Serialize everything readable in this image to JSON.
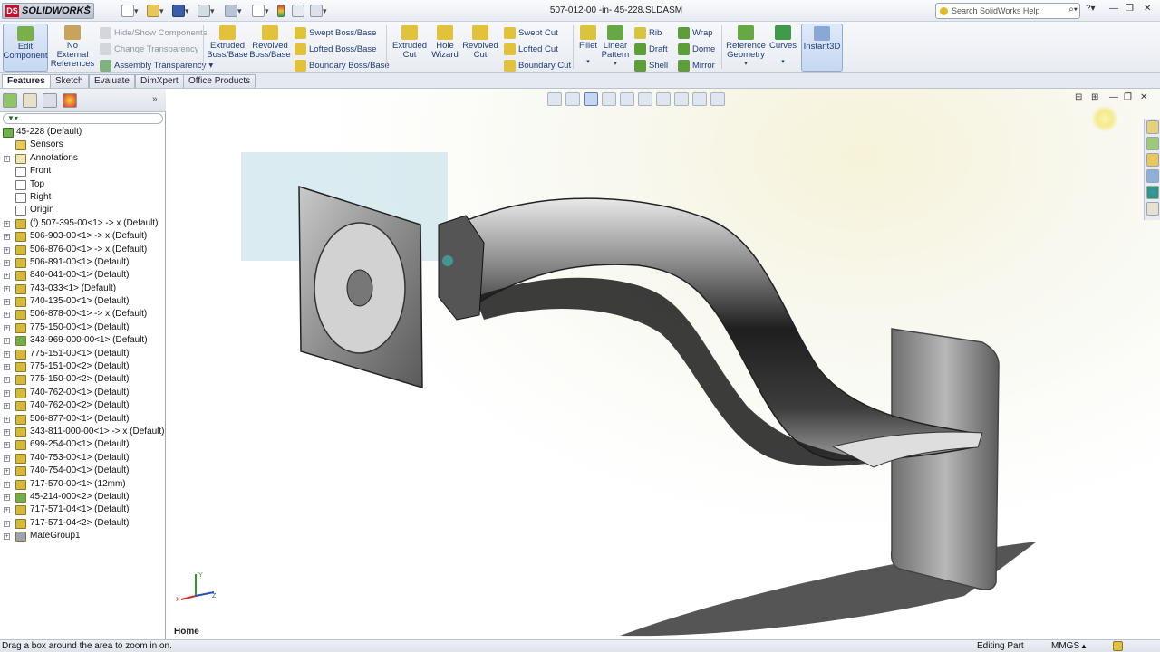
{
  "colors": {
    "accent": "#1f3d7a",
    "brand": "#c8102e",
    "selection": "#c6d8f2"
  },
  "titlebar": {
    "app_name": "SOLIDWORKS",
    "logo_mark": "DS",
    "doc_title": "507-012-00 -in- 45-228.SLDASM",
    "search_placeholder": "Search SolidWorks Help",
    "icons": [
      "new-icon",
      "open-icon",
      "save-icon",
      "print-icon",
      "undo-icon",
      "select-icon",
      "rebuild-icon",
      "options-icon"
    ]
  },
  "ribbon": {
    "edit_component": "Edit Component",
    "no_external_refs": "No External References",
    "hide_show": "Hide/Show Components",
    "change_transparency": "Change Transparency",
    "assembly_transparency": "Assembly Transparency",
    "extruded_boss": "Extruded Boss/Base",
    "revolved_boss": "Revolved Boss/Base",
    "swept_boss": "Swept Boss/Base",
    "lofted_boss": "Lofted Boss/Base",
    "boundary_boss": "Boundary Boss/Base",
    "extruded_cut": "Extruded Cut",
    "hole_wizard": "Hole Wizard",
    "revolved_cut": "Revolved Cut",
    "swept_cut": "Swept Cut",
    "lofted_cut": "Lofted Cut",
    "boundary_cut": "Boundary Cut",
    "fillet": "Fillet",
    "linear_pattern": "Linear Pattern",
    "rib": "Rib",
    "draft": "Draft",
    "shell": "Shell",
    "wrap": "Wrap",
    "dome": "Dome",
    "mirror": "Mirror",
    "reference_geometry": "Reference Geometry",
    "curves": "Curves",
    "instant3d": "Instant3D"
  },
  "tabs": [
    "Features",
    "Sketch",
    "Evaluate",
    "DimXpert",
    "Office Products"
  ],
  "tree": {
    "root": "45-228  (Default)",
    "items": [
      {
        "label": "Sensors",
        "icon": "sensor-icon"
      },
      {
        "label": "Annotations",
        "icon": "annotation-icon",
        "exp": true
      },
      {
        "label": "Front",
        "icon": "plane-icon"
      },
      {
        "label": "Top",
        "icon": "plane-icon"
      },
      {
        "label": "Right",
        "icon": "plane-icon"
      },
      {
        "label": "Origin",
        "icon": "origin-icon"
      },
      {
        "label": "(f) 507-395-00<1> -> x (Default)",
        "icon": "part-icon",
        "exp": true
      },
      {
        "label": "506-903-00<1> -> x (Default)",
        "icon": "part-icon",
        "exp": true
      },
      {
        "label": "506-876-00<1> -> x (Default)",
        "icon": "part-icon",
        "exp": true
      },
      {
        "label": "506-891-00<1> (Default)",
        "icon": "part-icon",
        "exp": true
      },
      {
        "label": "840-041-00<1> (Default)",
        "icon": "part-icon",
        "exp": true
      },
      {
        "label": "743-033<1> (Default)",
        "icon": "part-icon",
        "exp": true
      },
      {
        "label": "740-135-00<1> (Default)",
        "icon": "part-icon",
        "exp": true
      },
      {
        "label": "506-878-00<1> -> x (Default)",
        "icon": "part-icon",
        "exp": true
      },
      {
        "label": "775-150-00<1> (Default)",
        "icon": "part-icon",
        "exp": true
      },
      {
        "label": "343-969-000-00<1> (Default)",
        "icon": "assembly-icon",
        "exp": true
      },
      {
        "label": "775-151-00<1> (Default)",
        "icon": "part-icon",
        "exp": true
      },
      {
        "label": "775-151-00<2> (Default)",
        "icon": "part-icon",
        "exp": true
      },
      {
        "label": "775-150-00<2> (Default)",
        "icon": "part-icon",
        "exp": true
      },
      {
        "label": "740-762-00<1> (Default)",
        "icon": "part-icon",
        "exp": true
      },
      {
        "label": "740-762-00<2> (Default)",
        "icon": "part-icon",
        "exp": true
      },
      {
        "label": "506-877-00<1> (Default)",
        "icon": "part-icon",
        "exp": true
      },
      {
        "label": "343-811-000-00<1> -> x (Default)",
        "icon": "part-icon",
        "exp": true
      },
      {
        "label": "699-254-00<1> (Default)",
        "icon": "part-icon",
        "exp": true
      },
      {
        "label": "740-753-00<1> (Default)",
        "icon": "part-icon",
        "exp": true
      },
      {
        "label": "740-754-00<1> (Default)",
        "icon": "part-icon",
        "exp": true
      },
      {
        "label": "717-570-00<1> (12mm)",
        "icon": "part-icon",
        "exp": true
      },
      {
        "label": "45-214-000<2> (Default)",
        "icon": "assembly-icon",
        "exp": true
      },
      {
        "label": "717-571-04<1> (Default)",
        "icon": "part-icon",
        "exp": true
      },
      {
        "label": "717-571-04<2> (Default)",
        "icon": "part-icon",
        "exp": true
      },
      {
        "label": "MateGroup1",
        "icon": "mates-icon",
        "exp": true
      }
    ]
  },
  "viewport": {
    "home_label": "Home",
    "triad_labels": [
      "X",
      "Y",
      "Z"
    ]
  },
  "status": {
    "message": "Drag a box around the area to zoom in on.",
    "editing": "Editing Part",
    "units": "MMGS"
  }
}
